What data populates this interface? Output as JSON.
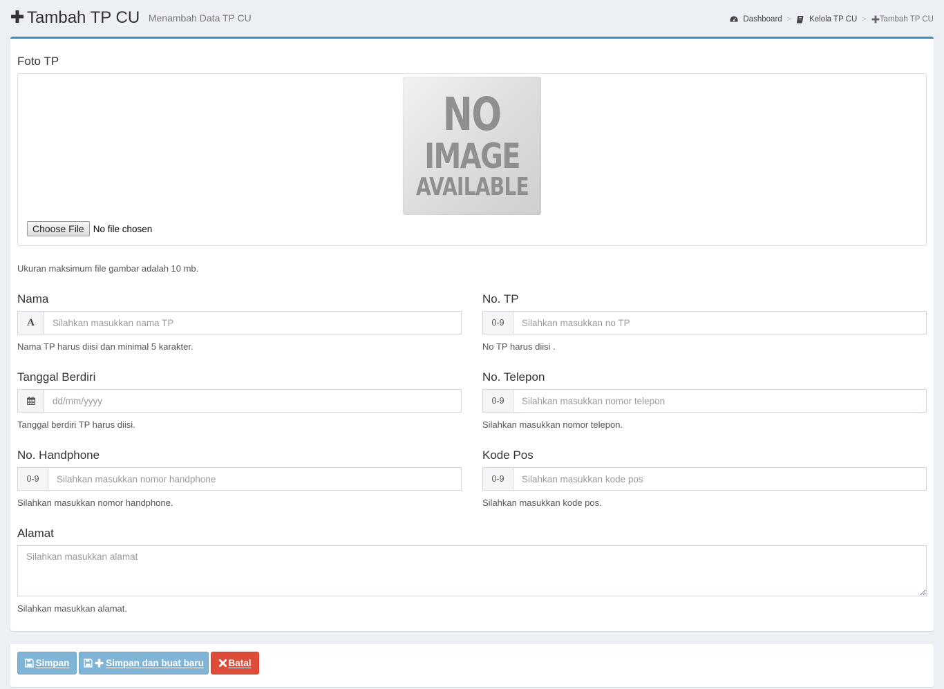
{
  "header": {
    "title": "Tambah TP CU",
    "subtitle": "Menambah Data TP CU",
    "breadcrumb": [
      {
        "label": "Dashboard",
        "icon": "dashboard-icon"
      },
      {
        "label": "Kelola TP CU",
        "icon": "book-icon"
      },
      {
        "label": "Tambah TP CU",
        "icon": "plus-icon"
      }
    ],
    "breadcrumb_separator": ">"
  },
  "form": {
    "foto": {
      "label": "Foto TP",
      "placeholder_image": [
        "NO",
        "IMAGE",
        "AVAILABLE"
      ],
      "choose_file_label": "Choose File",
      "file_status": "No file chosen",
      "help": "Ukuran maksimum file gambar adalah 10 mb."
    },
    "nama": {
      "label": "Nama",
      "addon": "A",
      "placeholder": "Silahkan masukkan nama TP",
      "help": "Nama TP harus diisi dan minimal 5 karakter."
    },
    "no_tp": {
      "label": "No. TP",
      "addon": "0-9",
      "placeholder": "Silahkan masukkan no TP",
      "help": "No TP harus diisi ."
    },
    "tanggal_berdiri": {
      "label": "Tanggal Berdiri",
      "addon_icon": "calendar-icon",
      "placeholder": "dd/mm/yyyy",
      "help": "Tanggal berdiri TP harus diisi."
    },
    "no_telepon": {
      "label": "No. Telepon",
      "addon": "0-9",
      "placeholder": "Silahkan masukkan nomor telepon",
      "help": "Silahkan masukkan nomor telepon."
    },
    "no_handphone": {
      "label": "No. Handphone",
      "addon": "0-9",
      "placeholder": "Silahkan masukkan nomor handphone",
      "help": "Silahkan masukkan nomor handphone."
    },
    "kode_pos": {
      "label": "Kode Pos",
      "addon": "0-9",
      "placeholder": "Silahkan masukkan kode pos",
      "help": "Silahkan masukkan kode pos."
    },
    "alamat": {
      "label": "Alamat",
      "placeholder": "Silahkan masukkan alamat",
      "help": "Silahkan masukkan alamat."
    }
  },
  "actions": {
    "simpan": {
      "label": "Simpan",
      "icon": "save-icon"
    },
    "simpan_baru": {
      "label": "Simpan dan buat baru",
      "icons": [
        "save-icon",
        "plus-icon"
      ]
    },
    "batal": {
      "label": "Batal",
      "icon": "close-icon"
    }
  },
  "colors": {
    "accent": "#3c8dbc",
    "primary_button": "#7fb4d6",
    "danger_button": "#dd4b39",
    "background": "#ecf0f5"
  }
}
